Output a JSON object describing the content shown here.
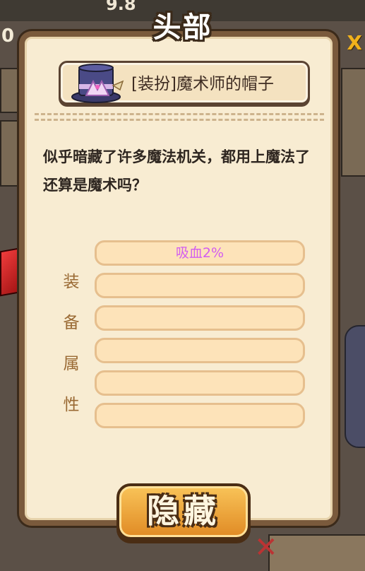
{
  "background": {
    "counter_left": "0",
    "top_value": "9.8"
  },
  "dialog": {
    "title": "头部",
    "item": {
      "name": "[装扮]魔术师的帽子",
      "icon": "magician-hat-icon"
    },
    "description": "似乎暗藏了许多魔法机关，都用上魔法了还算是魔术吗？",
    "attributes_label": [
      "装",
      "备",
      "属",
      "性"
    ],
    "attribute_slots": [
      "吸血2%",
      "",
      "",
      "",
      "",
      ""
    ],
    "hide_button_label": "隐藏"
  },
  "colors": {
    "attribute_text": "#d25cf0",
    "button": "#f0a83a",
    "panel": "#f8ecd2"
  }
}
